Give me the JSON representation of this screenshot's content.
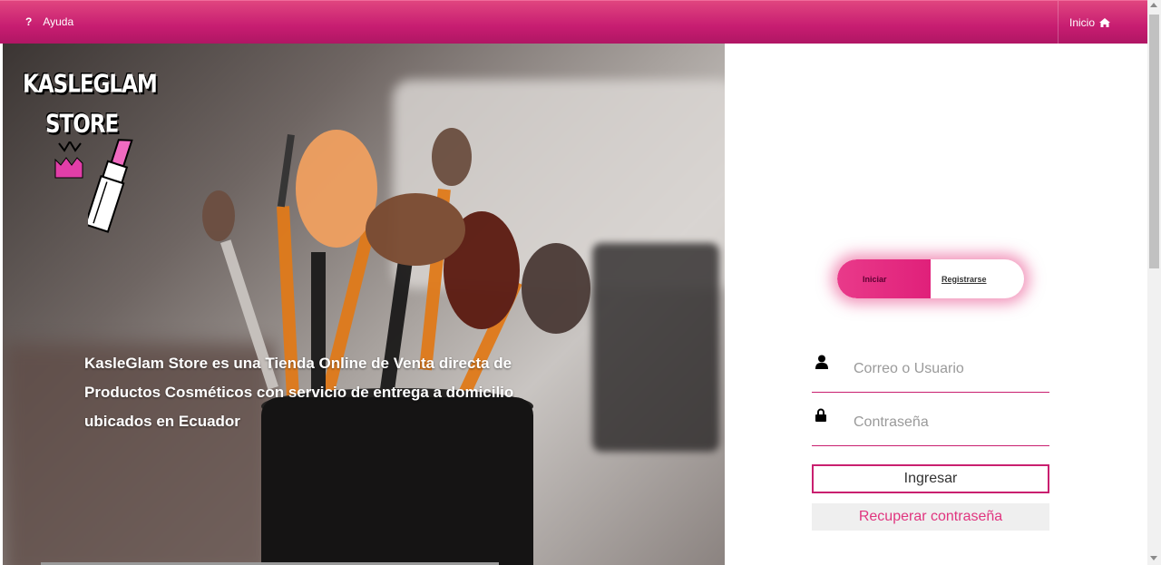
{
  "topbar": {
    "help_label": "Ayuda",
    "help_icon": "?",
    "home_label": "Inicio",
    "home_icon": "home-icon",
    "gradient_top": "#e0457f",
    "gradient_bottom": "#b01664"
  },
  "hero": {
    "logo_line1": "KASLEGLAM",
    "logo_line2": "STORE",
    "tagline": "KasleGlam Store es una Tienda Online de Venta directa de Productos Cosméticos con servicio de entrega a domicilio ubicados en Ecuador"
  },
  "auth": {
    "tab_login": "Iniciar",
    "tab_register": "Registrarse",
    "user_placeholder": "Correo o Usuario",
    "user_value": "",
    "password_placeholder": "Contraseña",
    "password_value": "",
    "login_button": "Ingresar",
    "recover_button": "Recuperar contraseña",
    "accent_color": "#c91f6f"
  }
}
